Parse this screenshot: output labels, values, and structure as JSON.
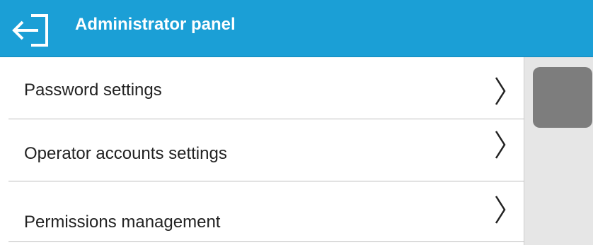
{
  "header": {
    "title": "Administrator panel",
    "back_icon": "back-arrow-icon",
    "background_color": "#1b9fd6"
  },
  "menu": {
    "items": [
      {
        "label": "Password settings",
        "icon": "chevron-right-icon"
      },
      {
        "label": "Operator accounts settings",
        "icon": "chevron-right-icon"
      },
      {
        "label": "Permissions management",
        "icon": "chevron-right-icon"
      }
    ]
  },
  "scrollbar": {
    "thumb_color": "#7d7d7d"
  }
}
